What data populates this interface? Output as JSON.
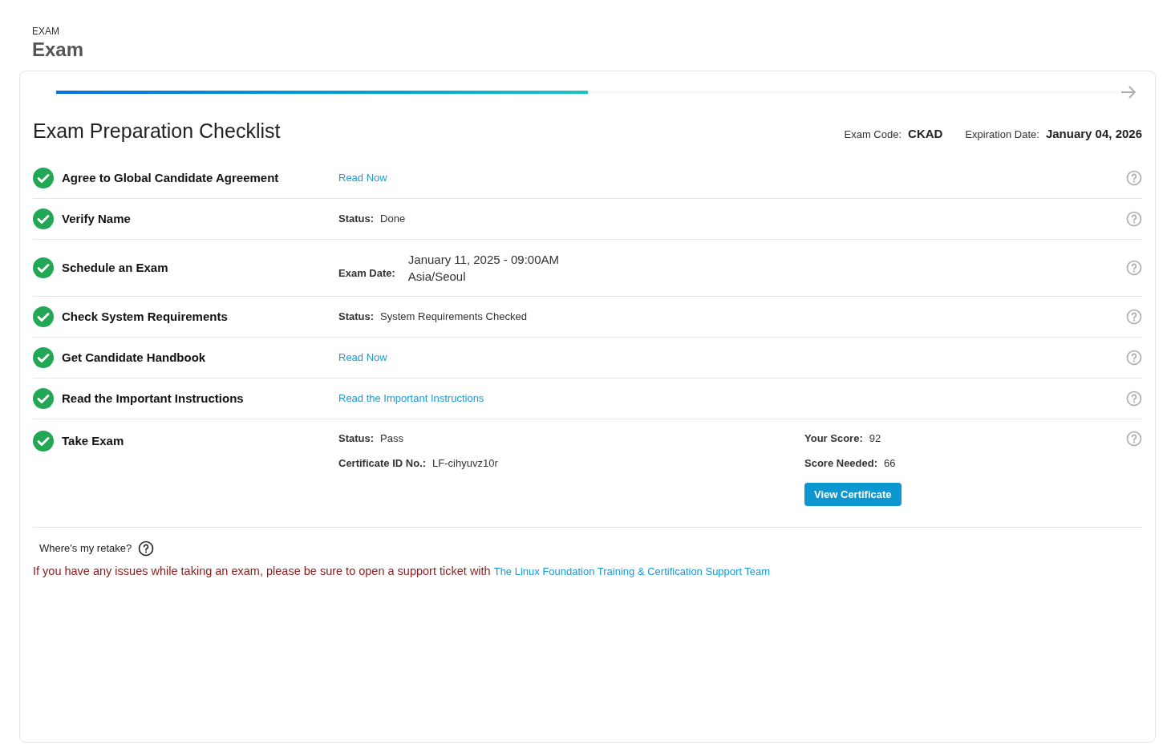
{
  "header": {
    "eyebrow": "EXAM",
    "title": "Exam"
  },
  "progress": {
    "level": 0.5
  },
  "checklist": {
    "title": "Exam Preparation Checklist",
    "exam_code_label": "Exam Code:",
    "exam_code": "CKAD",
    "expiration_label": "Expiration Date:",
    "expiration": "January 04, 2026"
  },
  "items": [
    {
      "title": "Agree to Global Candidate Agreement",
      "done": true,
      "kind": "link",
      "link": "Read Now"
    },
    {
      "title": "Verify Name",
      "done": true,
      "kind": "status",
      "label": "Status:",
      "value": "Done"
    },
    {
      "title": "Schedule an Exam",
      "done": true,
      "kind": "date",
      "label": "Exam Date:",
      "lines": [
        "January 11, 2025 - 09:00AM",
        "Asia/Seoul"
      ]
    },
    {
      "title": "Check System Requirements",
      "done": true,
      "kind": "status",
      "label": "Status:",
      "value": "System Requirements Checked"
    },
    {
      "title": "Get Candidate Handbook",
      "done": true,
      "kind": "link",
      "link": "Read Now"
    },
    {
      "title": "Read the Important Instructions",
      "done": true,
      "kind": "link",
      "link": "Read the Important Instructions"
    },
    {
      "title": "Take Exam",
      "done": true,
      "kind": "result",
      "fields": [
        {
          "label": "Status:",
          "value": "Pass"
        },
        {
          "label": "Certificate ID No.:",
          "value": "LF-cihyuvz10r"
        }
      ],
      "scores": [
        {
          "label": "Your Score:",
          "value": "92"
        },
        {
          "label": "Score Needed:",
          "value": "66"
        }
      ],
      "button": "View Certificate"
    }
  ],
  "retake": "Where's my retake?",
  "support": {
    "text": "If you have any issues while taking an exam, please be sure to open a support ticket with",
    "link": "The Linux Foundation Training & Certification Support Team"
  }
}
